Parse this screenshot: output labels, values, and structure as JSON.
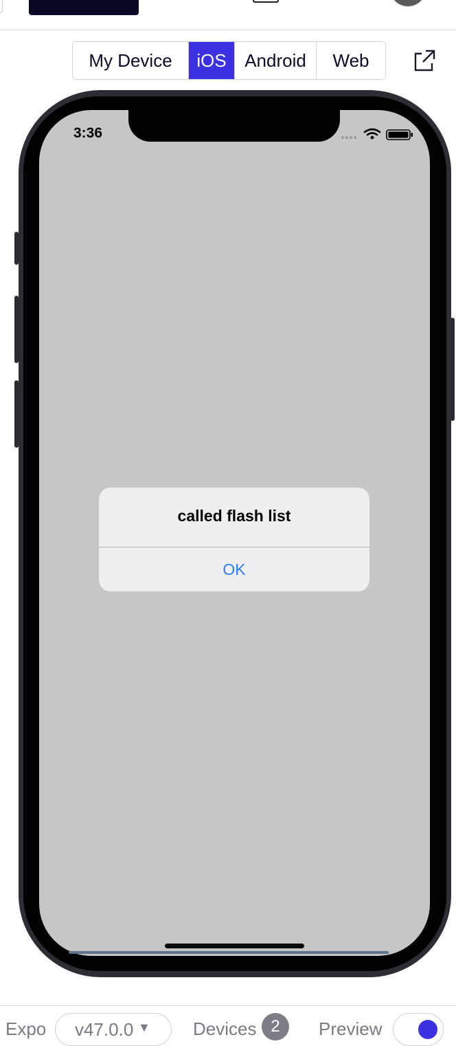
{
  "platform_tabs": [
    {
      "label": "My Device",
      "active": false
    },
    {
      "label": "iOS",
      "active": true
    },
    {
      "label": "Android",
      "active": false
    },
    {
      "label": "Web",
      "active": false
    }
  ],
  "icons": {
    "open_external": "external-link-icon",
    "wifi": "wifi-icon",
    "battery": "battery-icon",
    "signal": "signal-dots-icon",
    "dropdown": "caret-down-icon"
  },
  "device": {
    "status_time": "3:36",
    "alert": {
      "title": "called flash list",
      "button": "OK"
    }
  },
  "footer": {
    "sdk_label": "Expo",
    "sdk_version": "v47.0.0",
    "caret": "▼",
    "devices_label": "Devices",
    "devices_count": "2",
    "preview_label": "Preview",
    "preview_enabled": true
  },
  "colors": {
    "accent": "#3c31e0",
    "ios_link_blue": "#2a7ef5",
    "screen_gray": "#c6c6c8",
    "header_brand": "#070726"
  }
}
